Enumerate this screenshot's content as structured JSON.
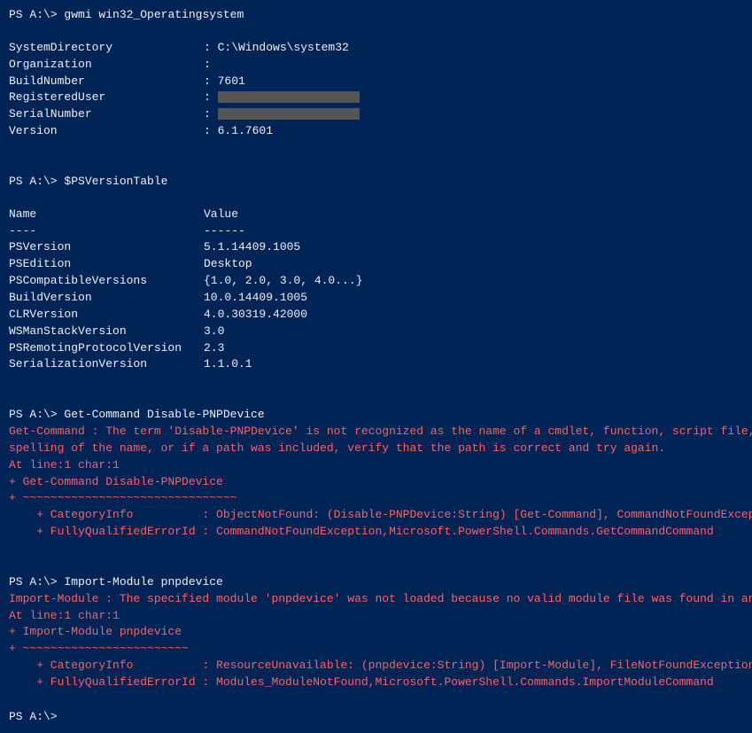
{
  "terminal": {
    "cmd1": {
      "prompt": "PS A:\\> ",
      "command": "gwmi win32_Operatingsystem"
    },
    "sysinfo": {
      "SystemDirectory_label": "SystemDirectory",
      "SystemDirectory_value": ": C:\\Windows\\system32",
      "Organization_label": "Organization",
      "Organization_value": ":",
      "BuildNumber_label": "BuildNumber",
      "BuildNumber_value": ": 7601",
      "RegisteredUser_label": "RegisteredUser",
      "RegisteredUser_value": ":",
      "SerialNumber_label": "SerialNumber",
      "SerialNumber_value": ":",
      "Version_label": "Version",
      "Version_value": ": 6.1.7601"
    },
    "cmd2": {
      "prompt": "PS A:\\> ",
      "command": "$PSVersionTable"
    },
    "pstable": {
      "col1": "Name",
      "col2": "Value",
      "sep1": "----",
      "sep2": "------",
      "rows": [
        {
          "name": "PSVersion",
          "value": "5.1.14409.1005"
        },
        {
          "name": "PSEdition",
          "value": "Desktop"
        },
        {
          "name": "PSCompatibleVersions",
          "value": "{1.0, 2.0, 3.0, 4.0...}"
        },
        {
          "name": "BuildVersion",
          "value": "10.0.14409.1005"
        },
        {
          "name": "CLRVersion",
          "value": "4.0.30319.42000"
        },
        {
          "name": "WSManStackVersion",
          "value": "3.0"
        },
        {
          "name": "PSRemotingProtocolVersion",
          "value": "2.3"
        },
        {
          "name": "SerializationVersion",
          "value": "1.1.0.1"
        }
      ]
    },
    "cmd3": {
      "prompt": "PS A:\\> ",
      "command": "Get-Command Disable-PNPDevice"
    },
    "error1": {
      "line1": "Get-Command : The term 'Disable-PNPDevice' is not recognized as the name of a cmdlet, function, script file, or oper",
      "line2": "spelling of the name, or if a path was included, verify that the path is correct and try again.",
      "line3": "At line:1 char:1",
      "line4": "+ Get-Command Disable-PNPDevice",
      "line5": "+ ~~~~~~~~~~~~~~~~~~~~~~~~~~~~~~~",
      "line6": "    + CategoryInfo          : ObjectNotFound: (Disable-PNPDevice:String) [Get-Command], CommandNotFoundException",
      "line7": "    + FullyQualifiedErrorId : CommandNotFoundException,Microsoft.PowerShell.Commands.GetCommandCommand"
    },
    "cmd4": {
      "prompt": "PS A:\\> ",
      "command": "Import-Module pnpdevice"
    },
    "error2": {
      "line1": "Import-Module : The specified module 'pnpdevice' was not loaded because no valid module file was found in any module",
      "line2": "At line:1 char:1",
      "line3": "+ Import-Module pnpdevice",
      "line4": "+ ~~~~~~~~~~~~~~~~~~~~~~~~",
      "line5": "    + CategoryInfo          : ResourceUnavailable: (pnpdevice:String) [Import-Module], FileNotFoundException",
      "line6": "    + FullyQualifiedErrorId : Modules_ModuleNotFound,Microsoft.PowerShell.Commands.ImportModuleCommand"
    },
    "cmd5": {
      "prompt": "PS A:\\> ",
      "command": ""
    }
  }
}
